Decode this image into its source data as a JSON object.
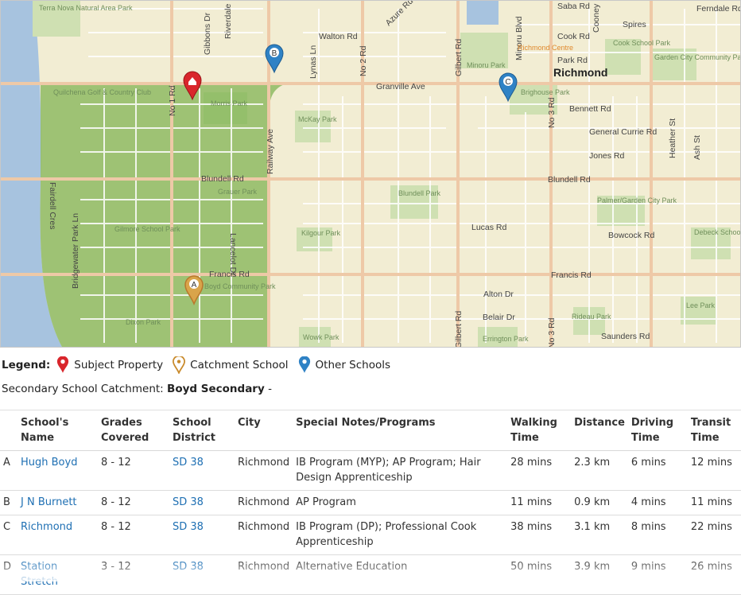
{
  "map": {
    "city_label": "Richmond",
    "roads": [
      "Granville Ave",
      "Blundell Rd",
      "Francis Rd",
      "Walton Rd",
      "Cook Rd",
      "Park Rd",
      "Bennett Rd",
      "General Currie Rd",
      "Jones Rd",
      "Lucas Rd",
      "Bowcock Rd",
      "Alton Dr",
      "Belair Dr",
      "Saunders Rd",
      "Saba Rd",
      "Spires",
      "Ferndale Rd",
      "Azure Rd",
      "Railway Ave",
      "No 1 Rd",
      "No 2 Rd",
      "No 3 Rd",
      "Gilbert Rd",
      "Gibbons Dr",
      "Riverdale",
      "Lynas Ln",
      "Heather St",
      "Ash St",
      "Minoru Blvd",
      "Cooney",
      "Lancelot Dr",
      "Fairdell Cres",
      "Bridgewater Park Ln"
    ],
    "places": [
      "Terra Nova Natural Area Park",
      "Quilchena Golf & Country Club",
      "Morris Park",
      "McKay Park",
      "Minoru Park",
      "Richmond Centre",
      "Brighouse Park",
      "Cook School Park",
      "Garden City Community Park",
      "Grauer Park",
      "Gilmore School Park",
      "Blundell Park",
      "Kilgour Park",
      "Palmer/Garden City Park",
      "Debeck School Park",
      "Hugh Boyd Community Park",
      "Dixon Park",
      "Wowk Park",
      "Rideau Park",
      "Lee Park",
      "Errington Park"
    ],
    "markers": [
      {
        "letter": "",
        "type": "subject",
        "color": "#d9262c"
      },
      {
        "letter": "A",
        "type": "catchment",
        "color": "#c98a2b"
      },
      {
        "letter": "B",
        "type": "other",
        "color": "#2f82c5"
      },
      {
        "letter": "C",
        "type": "other",
        "color": "#2f82c5"
      }
    ]
  },
  "legend": {
    "title": "Legend:",
    "items": [
      {
        "label": "Subject Property",
        "color": "#d9262c"
      },
      {
        "label": "Catchment School",
        "color": "#c98a2b"
      },
      {
        "label": "Other Schools",
        "color": "#2f82c5"
      }
    ]
  },
  "catchment": {
    "prefix": "Secondary School Catchment:",
    "school": "Boyd Secondary",
    "suffix": "-"
  },
  "table": {
    "headers": [
      "",
      "School's Name",
      "Grades Covered",
      "School District",
      "City",
      "Special Notes/Programs",
      "Walking Time",
      "Distance",
      "Driving Time",
      "Transit Time"
    ],
    "rows": [
      {
        "letter": "A",
        "name": "Hugh Boyd",
        "grades": "8 - 12",
        "district": "SD 38",
        "city": "Richmond",
        "notes": "IB Program (MYP); AP Program; Hair Design Apprenticeship",
        "walking": "28 mins",
        "distance": "2.3 km",
        "driving": "6 mins",
        "transit": "12 mins"
      },
      {
        "letter": "B",
        "name": "J N Burnett",
        "grades": "8 - 12",
        "district": "SD 38",
        "city": "Richmond",
        "notes": "AP Program",
        "walking": "11 mins",
        "distance": "0.9 km",
        "driving": "4 mins",
        "transit": "11 mins"
      },
      {
        "letter": "C",
        "name": "Richmond",
        "grades": "8 - 12",
        "district": "SD 38",
        "city": "Richmond",
        "notes": "IB Program (DP); Professional Cook Apprenticeship",
        "walking": "38 mins",
        "distance": "3.1 km",
        "driving": "8 mins",
        "transit": "22 mins"
      },
      {
        "letter": "D",
        "name": "Station Stretch",
        "grades": "3 - 12",
        "district": "SD 38",
        "city": "Richmond",
        "notes": "Alternative Education",
        "walking": "50 mins",
        "distance": "3.9 km",
        "driving": "9 mins",
        "transit": "26 mins"
      }
    ]
  }
}
